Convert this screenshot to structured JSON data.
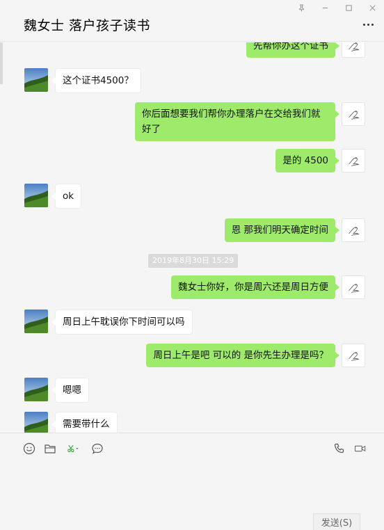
{
  "window": {
    "title": "魏女士 落户孩子读书"
  },
  "messages": [
    {
      "side": "out",
      "text": "先帮你办这个证书"
    },
    {
      "side": "in",
      "text": "这个证书4500？"
    },
    {
      "side": "out",
      "text": "你后面想要我们帮你办理落户在交给我们就好了"
    },
    {
      "side": "out",
      "text": "是的 4500"
    },
    {
      "side": "in",
      "text": "ok"
    },
    {
      "side": "out",
      "text": "恩  那我们明天确定时间"
    },
    {
      "side": "out",
      "text": "魏女士你好，你是周六还是周日方便"
    },
    {
      "side": "in",
      "text": "周日上午耽误你下时间可以吗"
    },
    {
      "side": "out",
      "text": "周日上午是吧 可以的 是你先生办理是吗？"
    },
    {
      "side": "in",
      "text": "嗯嗯"
    },
    {
      "side": "in",
      "text": "需要带什么"
    }
  ],
  "timestamp": "2019年8月30日 15:29",
  "composer": {
    "send_label": "发送(S)"
  },
  "colors": {
    "outgoing_bubble": "#9eea6a",
    "incoming_bubble": "#ffffff",
    "background": "#f5f5f5"
  },
  "icons": [
    "pin-icon",
    "minimize-icon",
    "maximize-icon",
    "close-icon",
    "more-icon",
    "emoji-icon",
    "folder-icon",
    "scissors-icon",
    "chat-bubble-icon",
    "phone-icon",
    "video-icon"
  ]
}
